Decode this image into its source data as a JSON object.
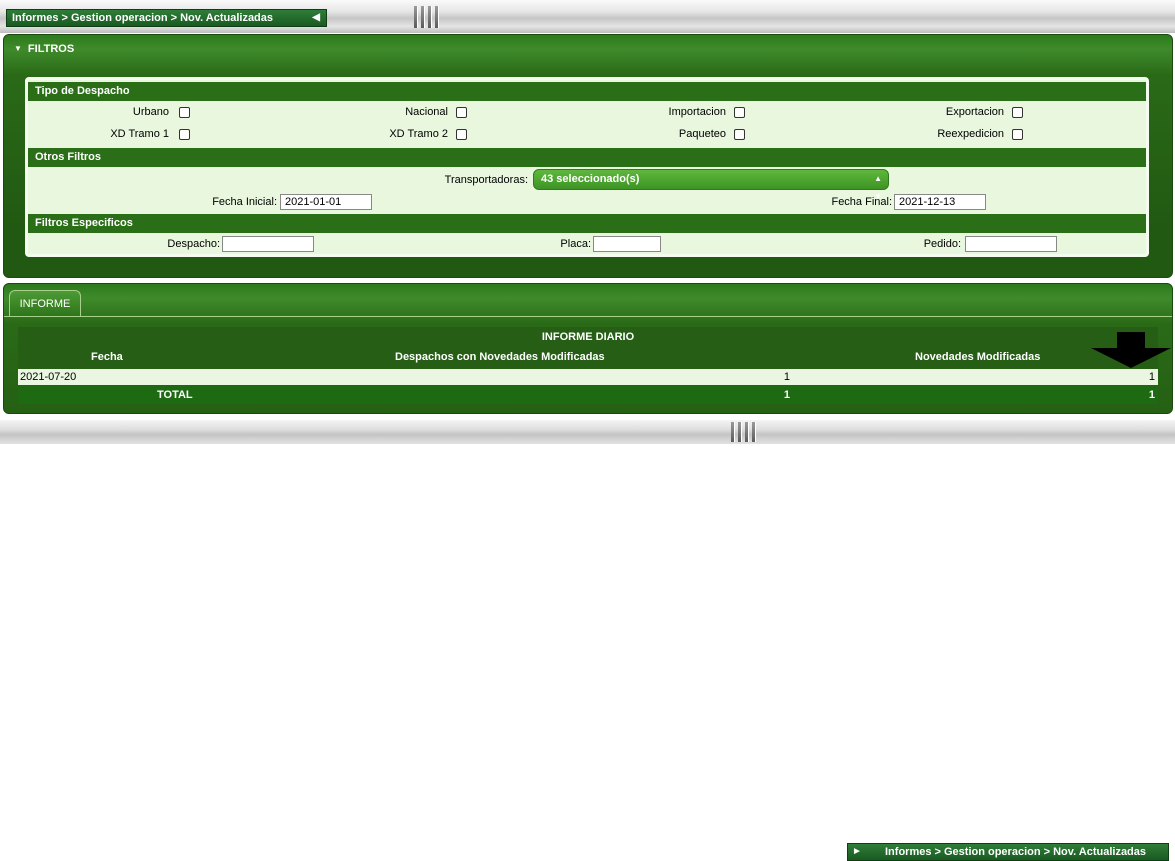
{
  "breadcrumb": {
    "text": "Informes > Gestion operacion > Nov. Actualizadas"
  },
  "filtros": {
    "title": "FILTROS",
    "tipo_despacho": {
      "heading": "Tipo de Despacho",
      "options": [
        {
          "label": "Urbano",
          "checked": false
        },
        {
          "label": "Nacional",
          "checked": false
        },
        {
          "label": "Importacion",
          "checked": false
        },
        {
          "label": "Exportacion",
          "checked": false
        },
        {
          "label": "XD Tramo 1",
          "checked": false
        },
        {
          "label": "XD Tramo 2",
          "checked": false
        },
        {
          "label": "Paqueteo",
          "checked": false
        },
        {
          "label": "Reexpedicion",
          "checked": false
        }
      ]
    },
    "otros": {
      "heading": "Otros Filtros",
      "transportadoras_label": "Transportadoras:",
      "transportadoras_value": "43 seleccionado(s)",
      "fecha_inicial_label": "Fecha Inicial:",
      "fecha_inicial_value": "2021-01-01",
      "fecha_final_label": "Fecha Final:",
      "fecha_final_value": "2021-12-13"
    },
    "especificos": {
      "heading": "Filtros Especificos",
      "despacho_label": "Despacho:",
      "despacho_value": "",
      "placa_label": "Placa:",
      "placa_value": "",
      "pedido_label": "Pedido:",
      "pedido_value": ""
    }
  },
  "informe": {
    "tab_label": "INFORME",
    "report_title": "INFORME DIARIO",
    "columns": [
      "Fecha",
      "Despachos con Novedades Modificadas",
      "Novedades Modificadas"
    ],
    "rows": [
      {
        "fecha": "2021-07-20",
        "despachos": "1",
        "novedades": "1"
      }
    ],
    "total": {
      "label": "TOTAL",
      "despachos": "1",
      "novedades": "1"
    }
  },
  "colors": {
    "panel_green": "#2a6f17",
    "light_green": "#e9f7df",
    "accent_green": "#4caf2f"
  }
}
